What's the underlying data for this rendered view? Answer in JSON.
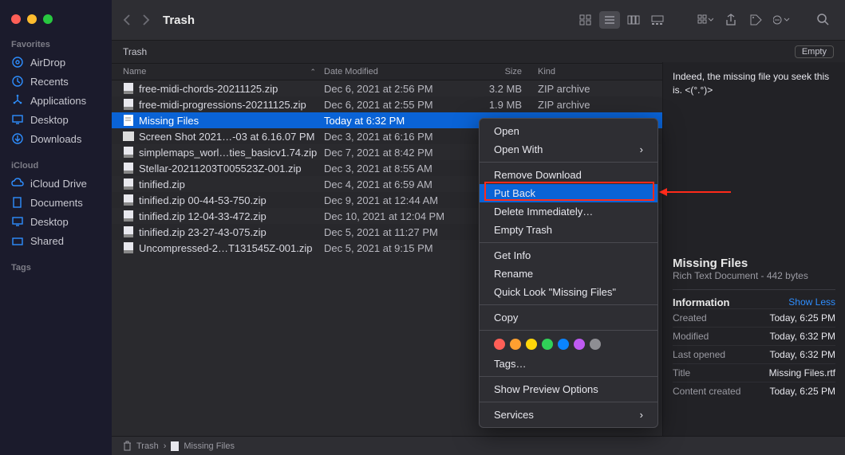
{
  "window": {
    "title": "Trash"
  },
  "sidebar": {
    "favorites_header": "Favorites",
    "icloud_header": "iCloud",
    "tags_header": "Tags",
    "favorites": [
      {
        "label": "AirDrop",
        "icon": "airdrop-icon"
      },
      {
        "label": "Recents",
        "icon": "clock-icon"
      },
      {
        "label": "Applications",
        "icon": "apps-icon"
      },
      {
        "label": "Desktop",
        "icon": "desktop-icon"
      },
      {
        "label": "Downloads",
        "icon": "downloads-icon"
      }
    ],
    "icloud": [
      {
        "label": "iCloud Drive",
        "icon": "cloud-icon"
      },
      {
        "label": "Documents",
        "icon": "documents-icon"
      },
      {
        "label": "Desktop",
        "icon": "desktop-icon"
      },
      {
        "label": "Shared",
        "icon": "shared-icon"
      }
    ]
  },
  "subheader": {
    "title": "Trash",
    "empty_label": "Empty"
  },
  "columns": {
    "name": "Name",
    "date": "Date Modified",
    "size": "Size",
    "kind": "Kind"
  },
  "files": [
    {
      "name": "free-midi-chords-20211125.zip",
      "date": "Dec 6, 2021 at 2:56 PM",
      "size": "3.2 MB",
      "kind": "ZIP archive",
      "icon": "file"
    },
    {
      "name": "free-midi-progressions-20211125.zip",
      "date": "Dec 6, 2021 at 2:55 PM",
      "size": "1.9 MB",
      "kind": "ZIP archive",
      "icon": "file"
    },
    {
      "name": "Missing Files",
      "date": "Today at 6:32 PM",
      "size": "",
      "kind": "",
      "icon": "rtf",
      "selected": true
    },
    {
      "name": "Screen Shot 2021…-03 at 6.16.07 PM",
      "date": "Dec 3, 2021 at 6:16 PM",
      "size": "",
      "kind": "",
      "icon": "img"
    },
    {
      "name": "simplemaps_worl…ties_basicv1.74.zip",
      "date": "Dec 7, 2021 at 8:42 PM",
      "size": "",
      "kind": "",
      "icon": "file"
    },
    {
      "name": "Stellar-20211203T005523Z-001.zip",
      "date": "Dec 3, 2021 at 8:55 AM",
      "size": "",
      "kind": "",
      "icon": "file"
    },
    {
      "name": "tinified.zip",
      "date": "Dec 4, 2021 at 6:59 AM",
      "size": "",
      "kind": "",
      "icon": "file"
    },
    {
      "name": "tinified.zip 00-44-53-750.zip",
      "date": "Dec 9, 2021 at 12:44 AM",
      "size": "",
      "kind": "",
      "icon": "file"
    },
    {
      "name": "tinified.zip 12-04-33-472.zip",
      "date": "Dec 10, 2021 at 12:04 PM",
      "size": "",
      "kind": "",
      "icon": "file"
    },
    {
      "name": "tinified.zip 23-27-43-075.zip",
      "date": "Dec 5, 2021 at 11:27 PM",
      "size": "",
      "kind": "",
      "icon": "file"
    },
    {
      "name": "Uncompressed-2…T131545Z-001.zip",
      "date": "Dec 5, 2021 at 9:15 PM",
      "size": "",
      "kind": "",
      "icon": "file"
    }
  ],
  "context_menu": {
    "open": "Open",
    "open_with": "Open With",
    "remove_download": "Remove Download",
    "put_back": "Put Back",
    "delete_immediately": "Delete Immediately…",
    "empty_trash": "Empty Trash",
    "get_info": "Get Info",
    "rename": "Rename",
    "quick_look": "Quick Look \"Missing Files\"",
    "copy": "Copy",
    "tags": "Tags…",
    "show_preview": "Show Preview Options",
    "services": "Services",
    "colors": [
      "#ff5f57",
      "#ffa030",
      "#ffd60a",
      "#30d158",
      "#0a84ff",
      "#bf5af2",
      "#8e8e93"
    ]
  },
  "preview": {
    "tip": "Indeed, the missing file you seek this is. <(°.°)>",
    "title": "Missing Files",
    "subtitle": "Rich Text Document - 442 bytes",
    "info_header": "Information",
    "show_less": "Show Less",
    "rows": [
      {
        "k": "Created",
        "v": "Today, 6:25 PM"
      },
      {
        "k": "Modified",
        "v": "Today, 6:32 PM"
      },
      {
        "k": "Last opened",
        "v": "Today, 6:32 PM"
      },
      {
        "k": "Title",
        "v": "Missing Files.rtf"
      },
      {
        "k": "Content created",
        "v": "Today, 6:25 PM"
      }
    ]
  },
  "pathbar": {
    "trash": "Trash",
    "sep": "›",
    "file": "Missing Files"
  }
}
